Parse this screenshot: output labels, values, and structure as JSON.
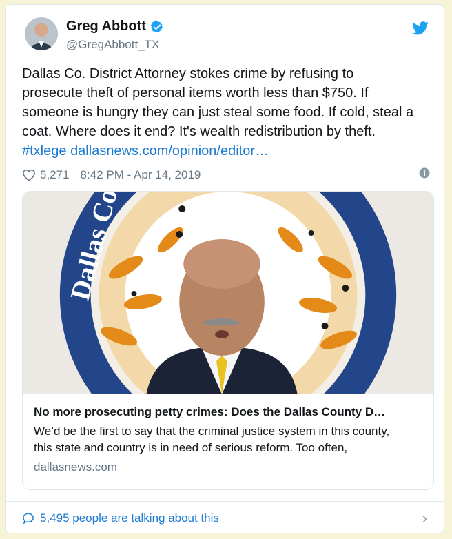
{
  "tweet": {
    "author_name": "Greg Abbott",
    "author_handle": "@GregAbbott_TX",
    "text_line1": "Dallas Co. District Attorney stokes crime by refusing to",
    "text_line2": "prosecute theft of personal items worth less than $750. If",
    "text_line3": "someone is hungry they can just steal some food. If cold, steal a",
    "text_line4": "coat. Where does it end? It's wealth redistribution by theft.",
    "hashtag": "#txlege",
    "link": "dallasnews.com/opinion/editor…",
    "likes": "5,271",
    "timestamp": "8:42 PM - Apr 14, 2019"
  },
  "link_card": {
    "image_seal_words": "Dallas County District Attorney",
    "title": "No more prosecuting petty crimes: Does the Dallas County D…",
    "description_line1": "We’d be the first to say that the criminal justice system in this county,",
    "description_line2": "this state and country is in need of serious reform. Too often,",
    "domain": "dallasnews.com"
  },
  "footer": {
    "talking": "5,495 people are talking about this"
  },
  "colors": {
    "link_blue": "#1b7ad1",
    "verified_blue": "#1da1f2",
    "muted": "#657786",
    "background": "#f7f3d6"
  },
  "icons": [
    "avatar",
    "verified-badge-icon",
    "twitter-bird-icon",
    "heart-icon",
    "info-icon",
    "speech-bubble-icon",
    "chevron-right-icon"
  ]
}
